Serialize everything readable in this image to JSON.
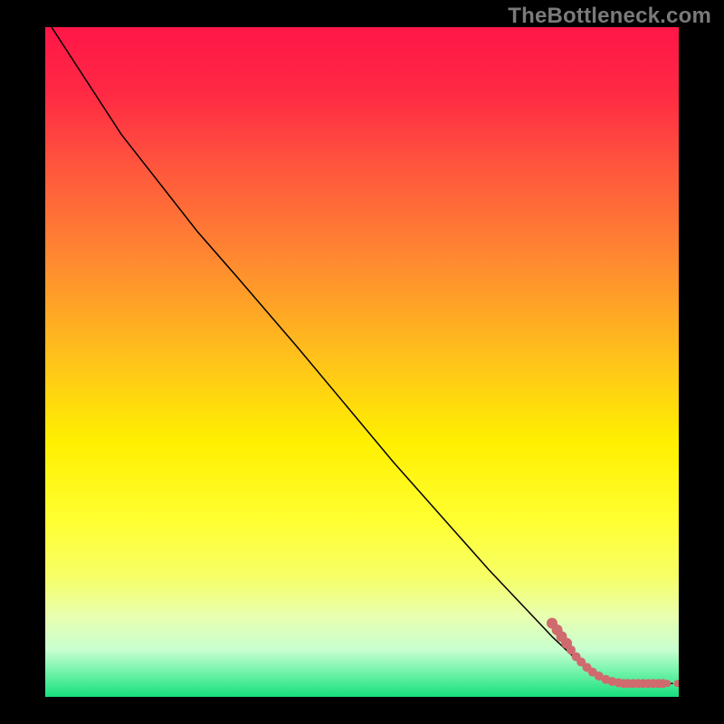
{
  "watermark": "TheBottleneck.com",
  "chart_data": {
    "type": "line",
    "title": "",
    "xlabel": "",
    "ylabel": "",
    "xlim": [
      0,
      100
    ],
    "ylim": [
      0,
      100
    ],
    "grid": false,
    "legend": false,
    "background_gradient": {
      "stops": [
        {
          "offset": 0.0,
          "color": "#ff1648"
        },
        {
          "offset": 0.1,
          "color": "#ff2a44"
        },
        {
          "offset": 0.22,
          "color": "#ff5a3c"
        },
        {
          "offset": 0.35,
          "color": "#ff8a30"
        },
        {
          "offset": 0.5,
          "color": "#ffc41a"
        },
        {
          "offset": 0.62,
          "color": "#fff000"
        },
        {
          "offset": 0.74,
          "color": "#ffff33"
        },
        {
          "offset": 0.82,
          "color": "#f6ff66"
        },
        {
          "offset": 0.88,
          "color": "#e8ffb0"
        },
        {
          "offset": 0.93,
          "color": "#c8ffd0"
        },
        {
          "offset": 0.965,
          "color": "#6cf2a8"
        },
        {
          "offset": 1.0,
          "color": "#18e07e"
        }
      ]
    },
    "series": [
      {
        "name": "curve",
        "style": "line",
        "color": "#000000",
        "width": 1.5,
        "points": [
          {
            "x": 1.0,
            "y": 100.0
          },
          {
            "x": 12.0,
            "y": 84.0
          },
          {
            "x": 24.0,
            "y": 69.5
          },
          {
            "x": 30.0,
            "y": 63.0
          },
          {
            "x": 40.0,
            "y": 52.0
          },
          {
            "x": 55.0,
            "y": 35.0
          },
          {
            "x": 70.0,
            "y": 19.0
          },
          {
            "x": 80.0,
            "y": 9.0
          },
          {
            "x": 84.5,
            "y": 5.0
          },
          {
            "x": 87.0,
            "y": 3.2
          },
          {
            "x": 89.0,
            "y": 2.4
          },
          {
            "x": 92.0,
            "y": 2.1
          },
          {
            "x": 96.0,
            "y": 2.0
          },
          {
            "x": 99.0,
            "y": 2.0
          }
        ]
      },
      {
        "name": "dots",
        "style": "scatter",
        "color": "#cf6a6f",
        "radius_default": 5,
        "points": [
          {
            "x": 80.0,
            "y": 11.0,
            "r": 6
          },
          {
            "x": 80.8,
            "y": 10.0,
            "r": 6
          },
          {
            "x": 81.5,
            "y": 9.0,
            "r": 6
          },
          {
            "x": 82.3,
            "y": 8.0,
            "r": 6
          },
          {
            "x": 83.0,
            "y": 7.0,
            "r": 5
          },
          {
            "x": 83.8,
            "y": 6.0,
            "r": 5
          },
          {
            "x": 84.6,
            "y": 5.2,
            "r": 5
          },
          {
            "x": 85.5,
            "y": 4.4,
            "r": 5
          },
          {
            "x": 86.4,
            "y": 3.7,
            "r": 5
          },
          {
            "x": 87.4,
            "y": 3.1,
            "r": 5
          },
          {
            "x": 88.5,
            "y": 2.6,
            "r": 5
          },
          {
            "x": 89.5,
            "y": 2.3,
            "r": 5
          },
          {
            "x": 90.5,
            "y": 2.1,
            "r": 5
          },
          {
            "x": 91.3,
            "y": 2.0,
            "r": 5
          },
          {
            "x": 92.0,
            "y": 2.0,
            "r": 5
          },
          {
            "x": 92.8,
            "y": 2.0,
            "r": 5
          },
          {
            "x": 93.6,
            "y": 2.0,
            "r": 5
          },
          {
            "x": 94.4,
            "y": 2.0,
            "r": 5
          },
          {
            "x": 95.2,
            "y": 2.0,
            "r": 5
          },
          {
            "x": 96.0,
            "y": 2.0,
            "r": 5
          },
          {
            "x": 96.8,
            "y": 2.0,
            "r": 5
          },
          {
            "x": 97.5,
            "y": 2.0,
            "r": 5
          },
          {
            "x": 98.2,
            "y": 2.0,
            "r": 4
          },
          {
            "x": 99.8,
            "y": 2.0,
            "r": 4
          }
        ]
      }
    ]
  }
}
